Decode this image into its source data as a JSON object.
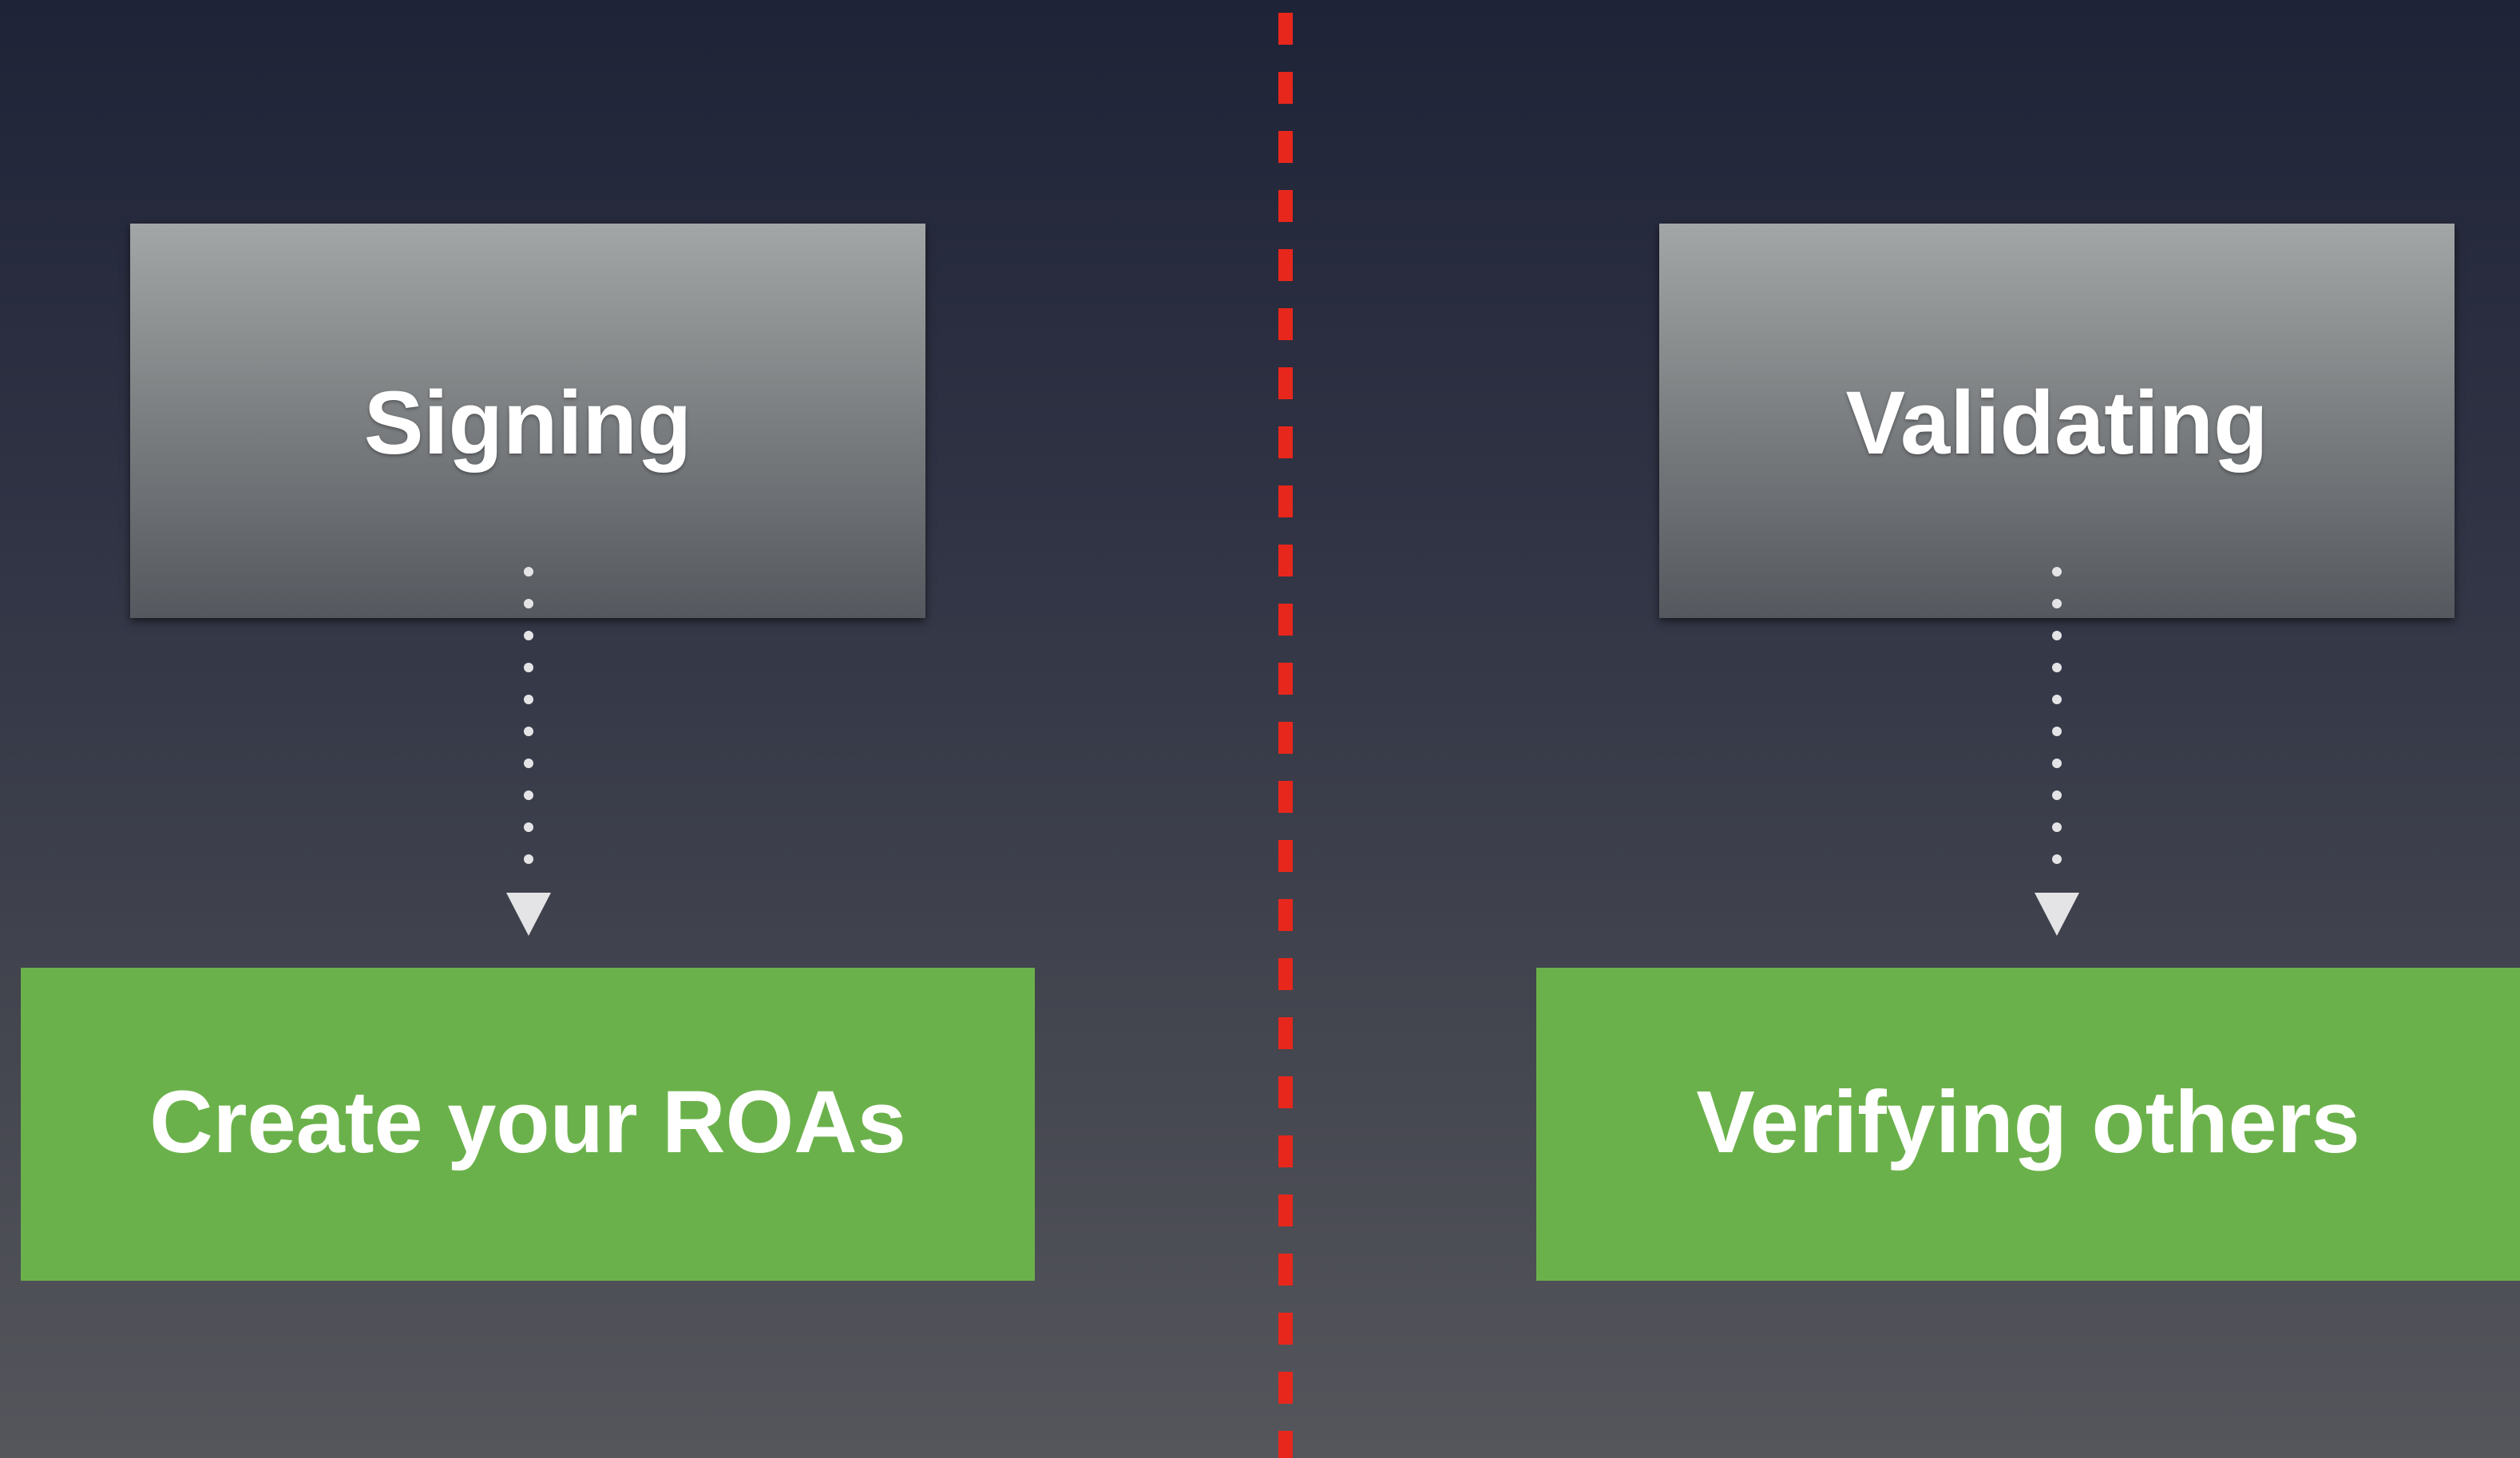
{
  "left": {
    "top_label": "Signing",
    "bottom_label": "Create your ROAs"
  },
  "right": {
    "top_label": "Validating",
    "bottom_label": "Verifying others"
  },
  "colors": {
    "divider": "#e8271c",
    "action_box": "#6bb14b",
    "header_box_top": "#a3a6a6",
    "header_box_bottom": "#55585e",
    "arrow": "#e4e4e6"
  }
}
